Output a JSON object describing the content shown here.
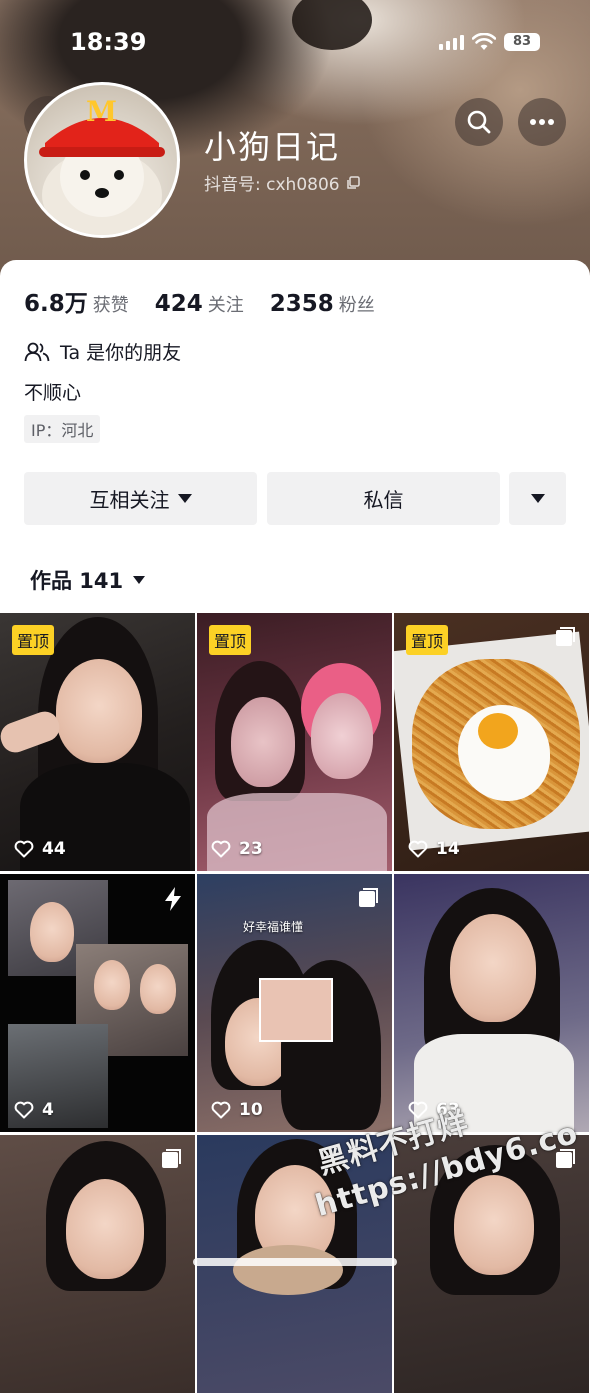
{
  "status_bar": {
    "time": "18:39",
    "battery": "83"
  },
  "profile": {
    "name": "小狗日记",
    "douyin_id": "抖音号: cxh0806",
    "avatar_badge": "M",
    "stats": [
      {
        "value": "6.8万",
        "label": "获赞"
      },
      {
        "value": "424",
        "label": "关注"
      },
      {
        "value": "2358",
        "label": "粉丝"
      }
    ],
    "friend_text": "Ta 是你的朋友",
    "bio": "不顺心",
    "ip": "IP：河北"
  },
  "actions": {
    "follow": "互相关注",
    "message": "私信"
  },
  "works": {
    "label": "作品 141"
  },
  "posts": [
    {
      "likes": "44",
      "badge": "置顶"
    },
    {
      "likes": "23",
      "badge": "置顶"
    },
    {
      "likes": "14",
      "badge": "置顶"
    },
    {
      "likes": "4",
      "badge": ""
    },
    {
      "likes": "10",
      "badge": "",
      "overlay_text": "好幸福谁懂"
    },
    {
      "likes": "63",
      "badge": ""
    },
    {
      "likes": "",
      "badge": ""
    },
    {
      "likes": "",
      "badge": ""
    },
    {
      "likes": "",
      "badge": ""
    }
  ],
  "watermark": {
    "line1": "黑料不打烊",
    "line2": "https://bdy6.co"
  },
  "colors": {
    "pinned": "#fcd125",
    "text": "#161823",
    "button_bg": "#f1f1f2"
  }
}
